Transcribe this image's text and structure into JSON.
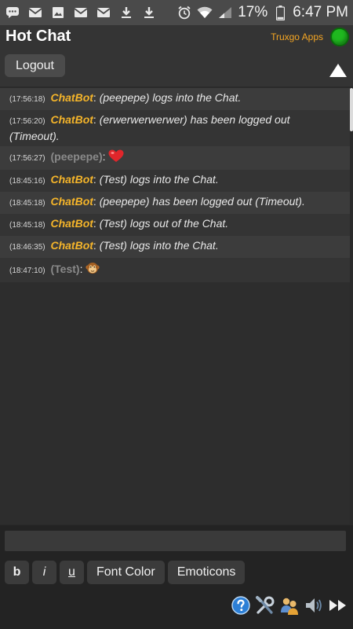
{
  "status_bar": {
    "battery_percent": "17%",
    "time": "6:47 PM",
    "left_icons": [
      "chat-bubble-icon",
      "gmail-icon",
      "image-icon",
      "gmail-icon",
      "gmail-icon",
      "download-icon",
      "download-icon"
    ],
    "right_icons": [
      "alarm-icon",
      "wifi-icon",
      "signal-icon",
      "battery-icon"
    ]
  },
  "header": {
    "title": "Hot Chat",
    "brand": "Truxgo Apps",
    "online_color": "#1fb81f",
    "logout_label": "Logout"
  },
  "messages": [
    {
      "time": "(17:56:18)",
      "sender": "ChatBot",
      "sep": ": ",
      "text": "(peepepe) logs into the Chat.",
      "type": "bot"
    },
    {
      "time": "(17:56:20)",
      "sender": "ChatBot",
      "sep": ": ",
      "text": "(erwerwerwerwer) has been logged out (Timeout).",
      "type": "bot"
    },
    {
      "time": "(17:56:27)",
      "sender": "(peepepe)",
      "sep": ": ",
      "text": "",
      "emoji": "heart-icon",
      "type": "user"
    },
    {
      "time": "(18:45:16)",
      "sender": "ChatBot",
      "sep": ": ",
      "text": "(Test) logs into the Chat.",
      "type": "bot"
    },
    {
      "time": "(18:45:18)",
      "sender": "ChatBot",
      "sep": ": ",
      "text": "(peepepe) has been logged out (Timeout).",
      "type": "bot"
    },
    {
      "time": "(18:45:18)",
      "sender": "ChatBot",
      "sep": ": ",
      "text": "(Test) logs out of the Chat.",
      "type": "bot"
    },
    {
      "time": "(18:46:35)",
      "sender": "ChatBot",
      "sep": ": ",
      "text": "(Test) logs into the Chat.",
      "type": "bot"
    },
    {
      "time": "(18:47:10)",
      "sender": "(Test)",
      "sep": ": ",
      "text": "",
      "emoji": "monkey-icon",
      "type": "user"
    }
  ],
  "composer": {
    "input_value": "",
    "bold_label": "b",
    "italic_label": "i",
    "underline_label": "u",
    "font_color_label": "Font Color",
    "emoticons_label": "Emoticons"
  },
  "bottom_icons": [
    "help-icon",
    "tools-icon",
    "users-icon",
    "speaker-icon",
    "fast-forward-icon"
  ],
  "colors": {
    "accent": "#f5b52a",
    "brand": "#f5a623",
    "background": "#2a2a2a"
  }
}
